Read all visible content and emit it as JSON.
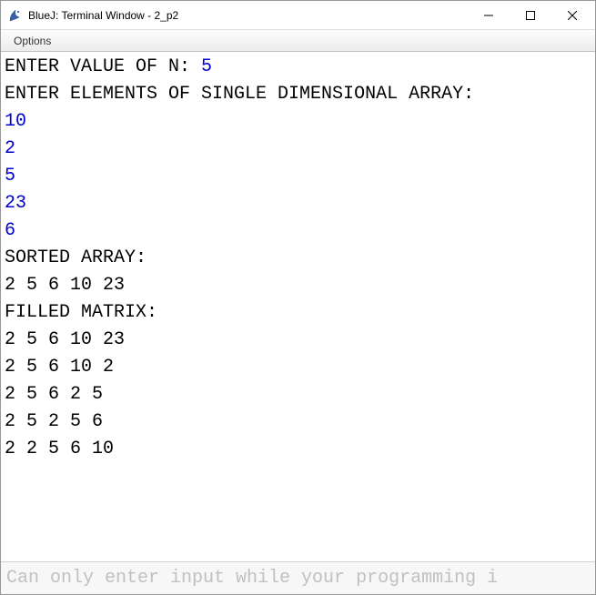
{
  "window": {
    "title": "BlueJ: Terminal Window - 2_p2"
  },
  "menu": {
    "options": "Options"
  },
  "terminal": {
    "prompt_n": "ENTER VALUE OF N: ",
    "input_n": "5",
    "prompt_elements": "ENTER ELEMENTS OF SINGLE DIMENSIONAL ARRAY:",
    "inputs": [
      "10",
      "2",
      "5",
      "23",
      "6"
    ],
    "sorted_label": "SORTED ARRAY:",
    "sorted_values": "2 5 6 10 23",
    "filled_label": "FILLED MATRIX:",
    "matrix": [
      "2 5 6 10 23",
      "2 5 6 10 2",
      "2 5 6 2 5",
      "2 5 2 5 6",
      "2 2 5 6 10"
    ]
  },
  "status": {
    "message": "Can only enter input while your programming i"
  }
}
